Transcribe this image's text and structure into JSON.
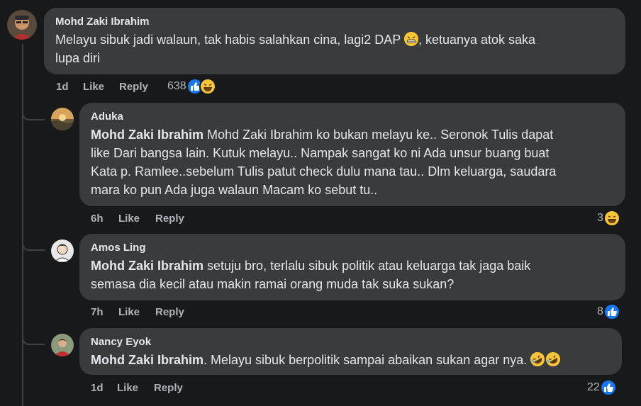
{
  "comments": [
    {
      "author": "Mohd Zaki Ibrahim",
      "text_before_emoji": "Melayu sibuk jadi walaun, tak habis salahkan cina, lagi2 DAP ",
      "text_line1_after": ", ketuanya atok saka",
      "text_line2": "lupa diri",
      "time": "1d",
      "like_label": "Like",
      "reply_label": "Reply",
      "reaction_count": "638",
      "reactions": [
        "like-icon",
        "haha-icon"
      ]
    },
    {
      "author": "Aduka",
      "mention": "Mohd Zaki Ibrahim",
      "lines": [
        " Mohd Zaki Ibrahim ko bukan melayu ke.. Seronok Tulis dapat",
        "like Dari bangsa lain. Kutuk melayu.. Nampak sangat ko ni Ada unsur buang buat",
        "Kata p. Ramlee..sebelum Tulis patut check dulu mana tau.. Dlm keluarga, saudara",
        "mara ko pun Ada juga walaun Macam ko sebut tu.."
      ],
      "time": "6h",
      "like_label": "Like",
      "reply_label": "Reply",
      "reaction_count": "3",
      "reactions": [
        "haha-icon"
      ]
    },
    {
      "author": "Amos Ling",
      "mention": "Mohd Zaki Ibrahim",
      "lines": [
        " setuju bro, terlalu sibuk politik atau keluarga tak jaga baik",
        "semasa dia kecil atau makin ramai orang muda tak suka sukan?"
      ],
      "time": "7h",
      "like_label": "Like",
      "reply_label": "Reply",
      "reaction_count": "8",
      "reactions": [
        "like-icon"
      ]
    },
    {
      "author": "Nancy Eyok",
      "mention": "Mohd Zaki Ibrahim",
      "text": ". Melayu sibuk berpolitik sampai abaikan sukan agar nya. ",
      "time": "1d",
      "like_label": "Like",
      "reply_label": "Reply",
      "reaction_count": "22",
      "reactions": [
        "like-icon"
      ]
    }
  ],
  "colors": {
    "background": "#18191a",
    "bubble": "#3a3b3c",
    "text": "#e4e6eb",
    "muted": "#b0b3b8",
    "like_blue": "#1877f2",
    "haha_yellow": "#f7c43a"
  }
}
